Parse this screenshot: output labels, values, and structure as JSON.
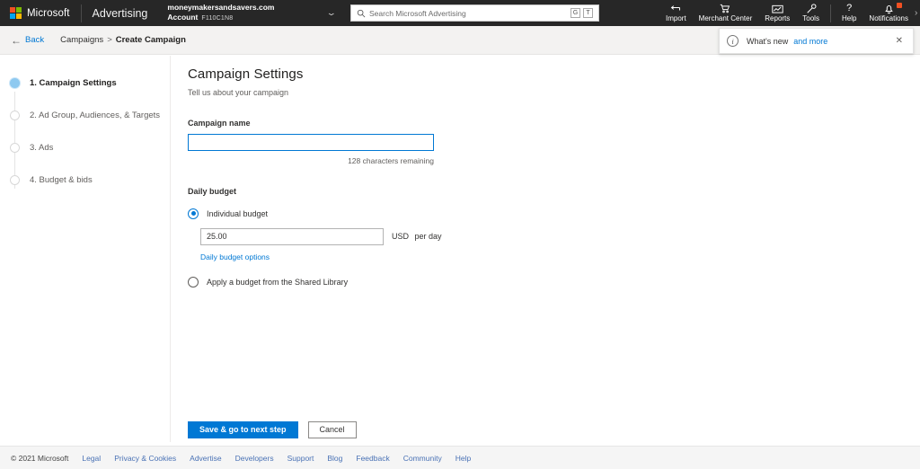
{
  "header": {
    "brand_name": "Microsoft",
    "product_name": "Advertising",
    "account_domain": "moneymakersandsavers.com",
    "account_label": "Account",
    "account_id": "F110C1N8",
    "account_chevron_icon": "chevron-down-icon",
    "logo_colors": {
      "red": "#f25022",
      "green": "#7fba00",
      "blue": "#00a4ef",
      "yellow": "#ffb900"
    },
    "background": "#272727"
  },
  "search": {
    "placeholder": "Search Microsoft Advertising",
    "value": "",
    "icon": "search-icon",
    "key_hints": [
      "G",
      "T"
    ]
  },
  "topnav": {
    "items": [
      {
        "label": "Import",
        "icon": "import-arrow-icon"
      },
      {
        "label": "Merchant Center",
        "icon": "shopping-cart-icon"
      },
      {
        "label": "Reports",
        "icon": "chart-line-icon"
      },
      {
        "label": "Tools",
        "icon": "wrench-icon"
      }
    ],
    "right_items": [
      {
        "label": "Help",
        "icon": "question-mark-icon"
      },
      {
        "label": "Notifications",
        "icon": "bell-icon",
        "badge": true
      }
    ]
  },
  "breadcrumb": {
    "back_label": "Back",
    "back_icon": "arrow-left-icon",
    "parent": "Campaigns",
    "separator": ">",
    "current": "Create Campaign"
  },
  "whats_new": {
    "icon": "info-circle-icon",
    "text": "What's new",
    "link_text": "and more",
    "close_icon": "close-icon",
    "link_color": "#0078d4"
  },
  "sidebar": {
    "steps": [
      {
        "label": "1. Campaign Settings",
        "active": true
      },
      {
        "label": "2. Ad Group, Audiences, & Targets",
        "active": false
      },
      {
        "label": "3. Ads",
        "active": false
      },
      {
        "label": "4. Budget & bids",
        "active": false
      }
    ],
    "active_dot_color": "#8ec9f0"
  },
  "main": {
    "title": "Campaign Settings",
    "subtitle": "Tell us about your campaign",
    "campaign_name": {
      "label": "Campaign name",
      "value": "",
      "placeholder": "",
      "helper": "128 characters remaining"
    },
    "daily_budget": {
      "section_label": "Daily budget",
      "option_individual": "Individual budget",
      "option_individual_selected": true,
      "budget_value": "25.00",
      "currency": "USD",
      "per_unit": "per day",
      "options_link": "Daily budget options",
      "option_shared": "Apply a budget from the Shared Library",
      "option_shared_selected": false
    }
  },
  "actions": {
    "primary_label": "Save & go to next step",
    "secondary_label": "Cancel",
    "primary_color": "#0078d4"
  },
  "footer": {
    "copyright": "© 2021 Microsoft",
    "links": [
      "Legal",
      "Privacy & Cookies",
      "Advertise",
      "Developers",
      "Support",
      "Blog",
      "Feedback",
      "Community",
      "Help"
    ]
  }
}
